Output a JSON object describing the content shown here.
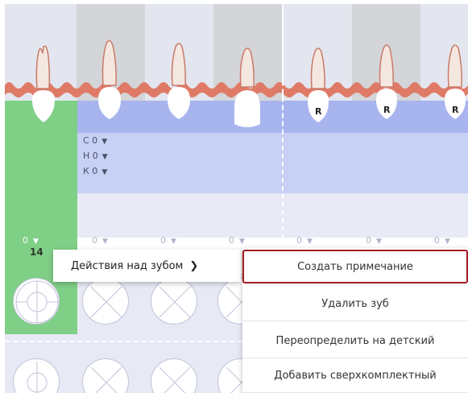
{
  "dental_chart": {
    "tooth_number": "14",
    "restoration_marker": "R",
    "checks": [
      {
        "label": "С 0",
        "icon": "caret-down-icon"
      },
      {
        "label": "Н 0",
        "icon": "caret-down-icon"
      },
      {
        "label": "К 0",
        "icon": "caret-down-icon"
      }
    ],
    "mobility_selects": [
      "0",
      "0",
      "0",
      "0",
      "0",
      "0",
      "0"
    ],
    "colors": {
      "selected_green": "#7fcf86",
      "gum": "#df7a67",
      "panel_blue": "#a8b4ee",
      "panel_pale": "#c7d0f5",
      "highlight_border": "#a11c22"
    }
  },
  "context_menu": {
    "parent_label": "Действия над зубом",
    "chevron_icon": "chevron-right-icon",
    "items": [
      "Создать примечание",
      "Удалить зуб",
      "Переопределить на детский",
      "Добавить сверхкомплектный"
    ],
    "active_index": 0
  }
}
